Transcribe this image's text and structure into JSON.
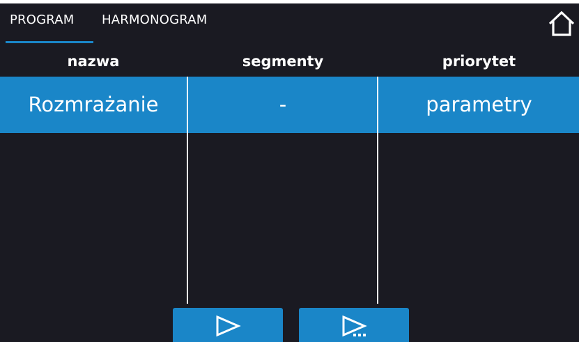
{
  "tabs": [
    {
      "label": "PROGRAM",
      "active": true
    },
    {
      "label": "HARMONOGRAM",
      "active": false
    }
  ],
  "home_icon": "home-icon",
  "table": {
    "columns": [
      "nazwa",
      "segmenty",
      "priorytet"
    ],
    "rows": [
      {
        "nazwa": "Rozmrażanie",
        "segmenty": "-",
        "priorytet": "parametry",
        "selected": true
      }
    ]
  },
  "buttons": [
    {
      "icon": "play-icon"
    },
    {
      "icon": "play-more-icon"
    }
  ],
  "colors": {
    "background": "#1a1a22",
    "accent": "#1a86c8",
    "text": "#ffffff"
  }
}
